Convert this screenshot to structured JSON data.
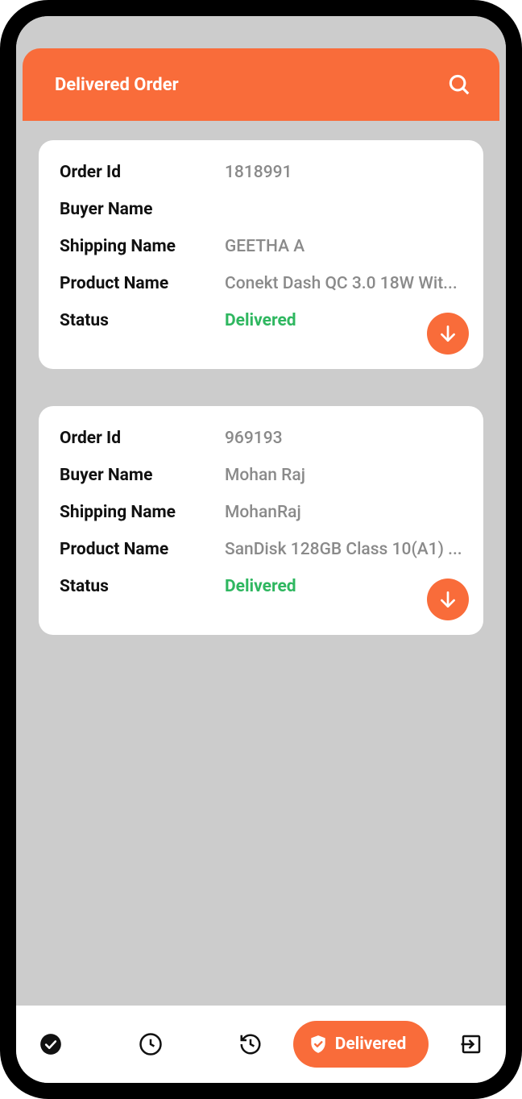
{
  "appbar": {
    "title": "Delivered Order"
  },
  "labels": {
    "order_id": "Order Id",
    "buyer_name": "Buyer Name",
    "shipping_name": "Shipping Name",
    "product_name": "Product Name",
    "status": "Status"
  },
  "orders": [
    {
      "order_id": "1818991",
      "buyer_name": "",
      "shipping_name": "GEETHA A",
      "product_name": "Conekt Dash QC 3.0 18W Wit...",
      "status": "Delivered"
    },
    {
      "order_id": "969193",
      "buyer_name": "Mohan Raj",
      "shipping_name": "MohanRaj",
      "product_name": "SanDisk 128GB Class 10(A1) ...",
      "status": "Delivered"
    }
  ],
  "bottombar": {
    "active_label": "Delivered"
  }
}
